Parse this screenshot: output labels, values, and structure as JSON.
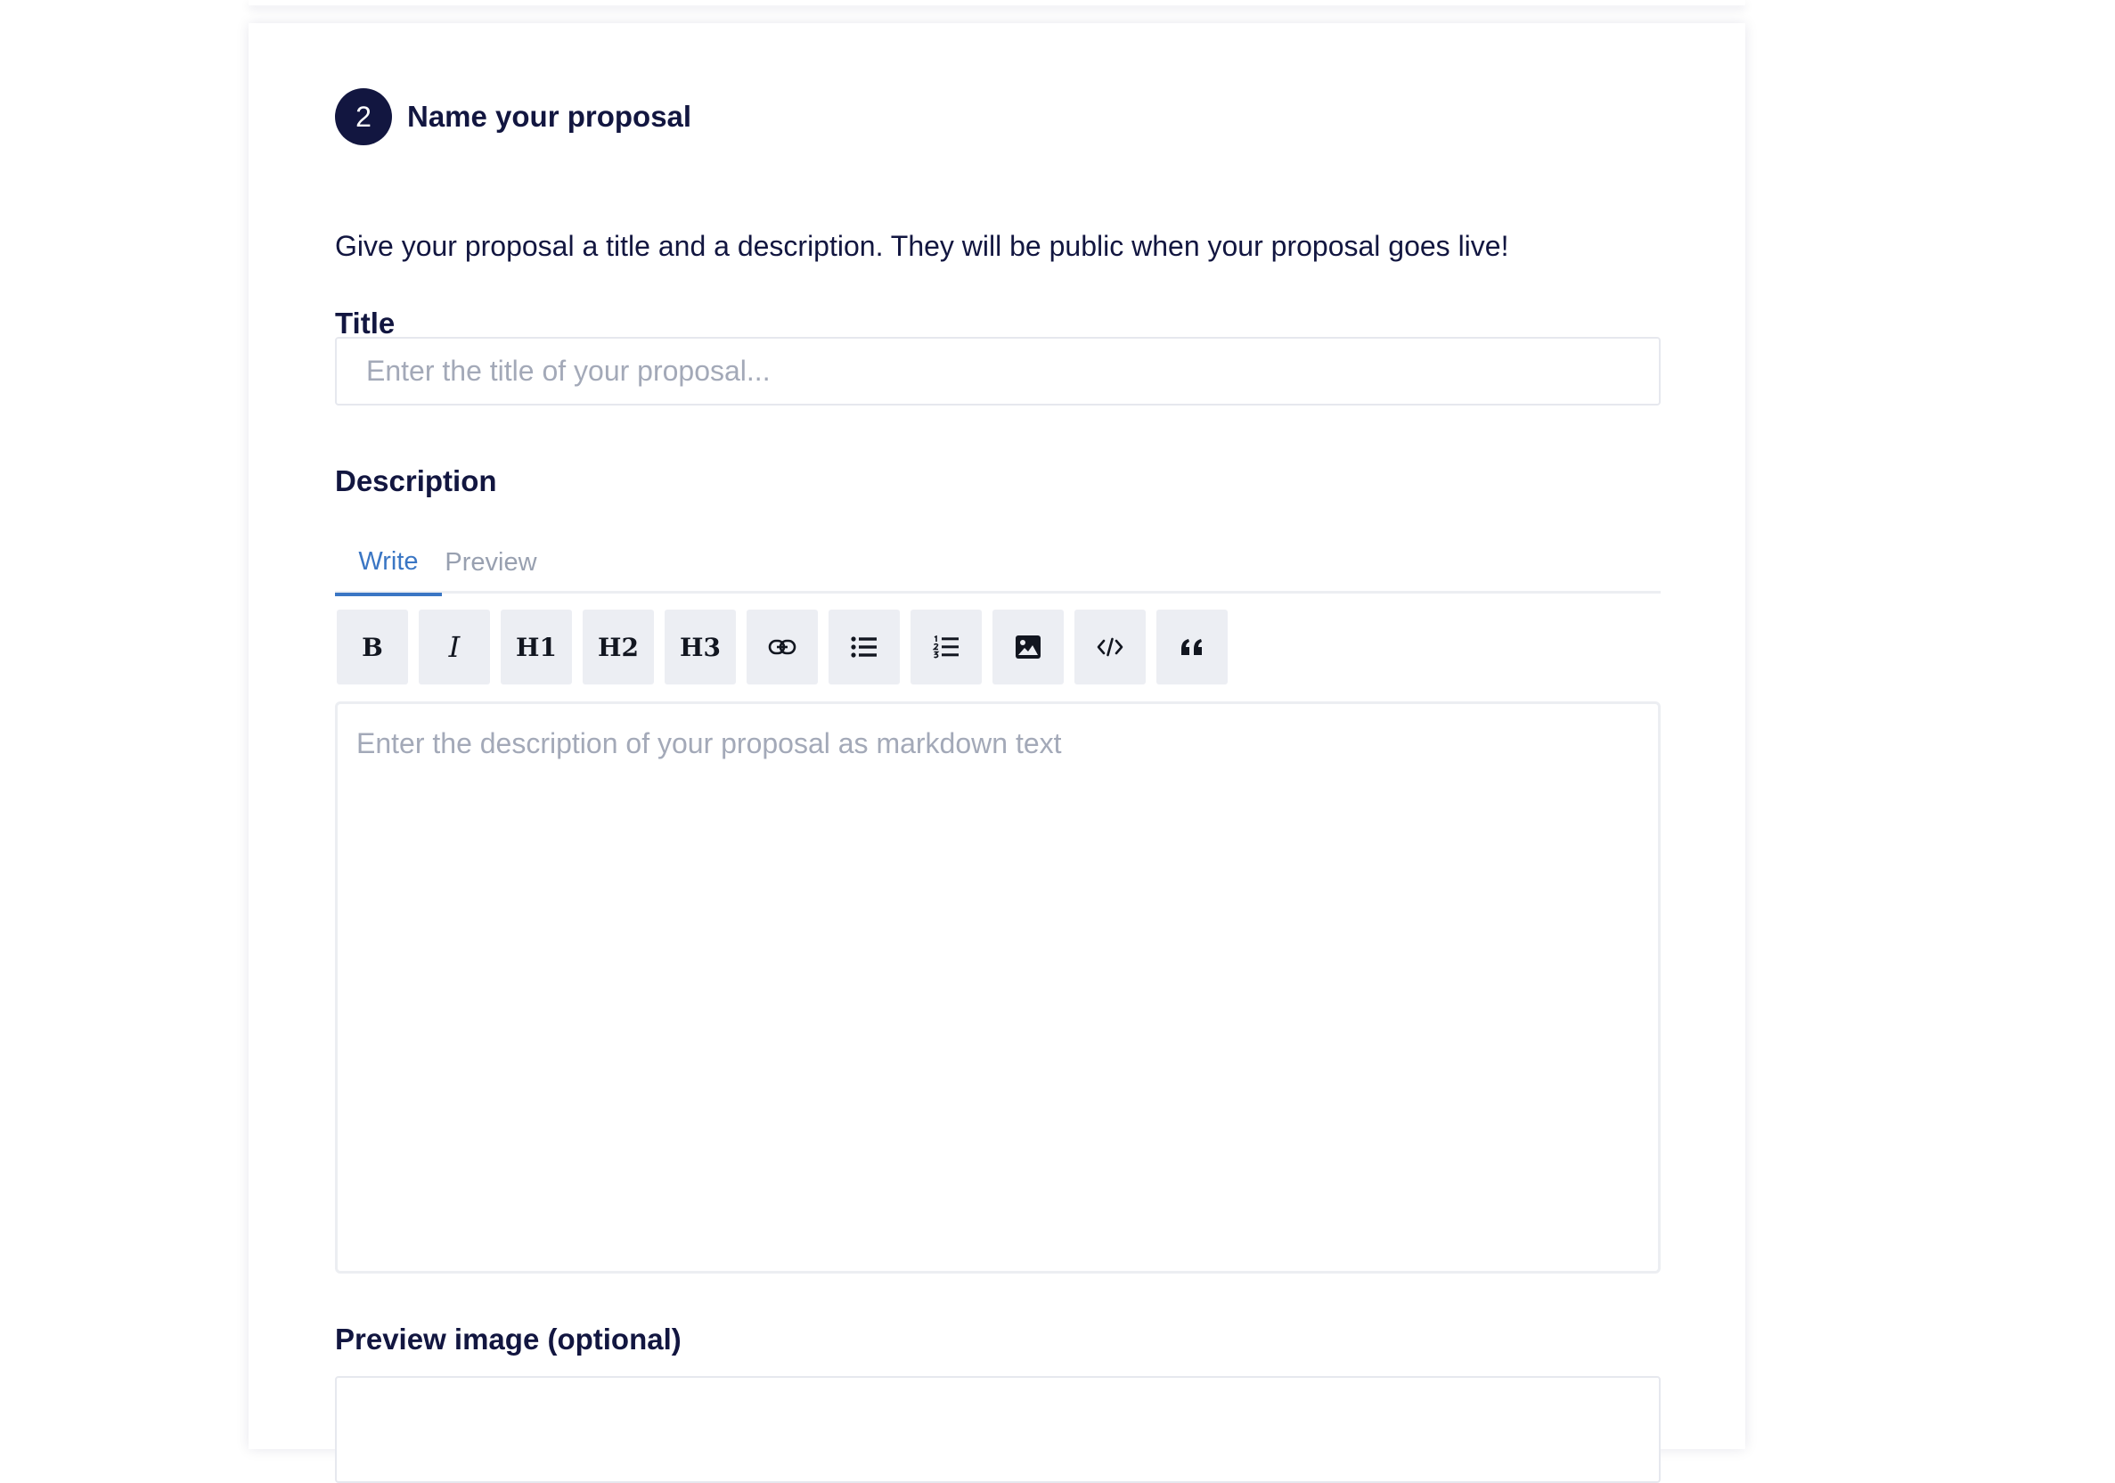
{
  "step": {
    "number": "2",
    "title": "Name your proposal"
  },
  "intro_text": "Give your proposal a title and a description. They will be public when your proposal goes live!",
  "title_field": {
    "label": "Title",
    "value": "",
    "placeholder": "Enter the title of your proposal..."
  },
  "description": {
    "label": "Description",
    "tabs": [
      {
        "label": "Write",
        "active": true
      },
      {
        "label": "Preview",
        "active": false
      }
    ],
    "toolbar": {
      "bold": "B",
      "italic": "I",
      "h1": "H1",
      "h2": "H2",
      "h3": "H3",
      "icons": [
        "link-icon",
        "bullet-list-icon",
        "numbered-list-icon",
        "image-icon",
        "code-icon",
        "quote-icon"
      ]
    },
    "value": "",
    "placeholder": "Enter the description of your proposal as markdown text"
  },
  "preview_image": {
    "label": "Preview image (optional)"
  },
  "colors": {
    "primary": "#121640",
    "accent": "#3a76c4",
    "muted": "#98a0b0",
    "toolbar_bg": "#eceef3"
  }
}
